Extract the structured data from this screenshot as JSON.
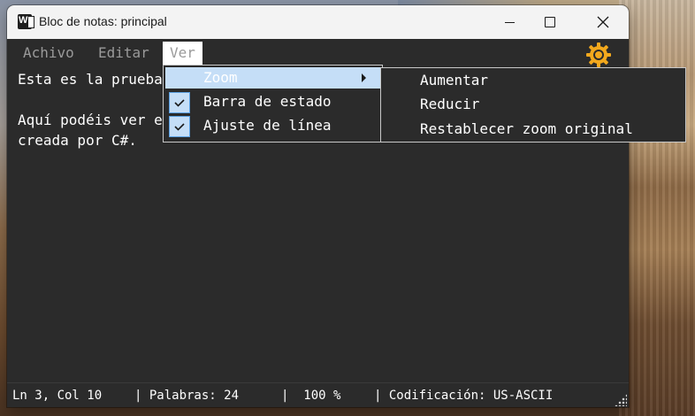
{
  "window": {
    "title": "Bloc de notas: principal"
  },
  "menubar": {
    "items": [
      {
        "label": "Achivo"
      },
      {
        "label": "Editar"
      },
      {
        "label": "Ver"
      }
    ],
    "settings_icon": "gear-icon"
  },
  "editor": {
    "lines": [
      "Esta es la prueba",
      "",
      "Aquí podéis ver e",
      "creada por C#."
    ]
  },
  "ver_menu": {
    "items": [
      {
        "label": "Zoom",
        "has_submenu": true,
        "highlighted": true
      },
      {
        "label": "Barra de estado",
        "checked": true
      },
      {
        "label": "Ajuste de línea",
        "checked": true
      }
    ]
  },
  "zoom_submenu": {
    "items": [
      {
        "label": "Aumentar"
      },
      {
        "label": "Reducir"
      },
      {
        "label": "Restablecer zoom original"
      }
    ]
  },
  "statusbar": {
    "position": "Ln 3, Col 10",
    "words": "| Palabras: 24",
    "zoom": "|  100 %",
    "encoding": "| Codificación: US-ASCII"
  },
  "colors": {
    "editor_bg": "#2b2b2b",
    "menu_highlight": "#c5def7",
    "gear": "#f2a81d"
  }
}
